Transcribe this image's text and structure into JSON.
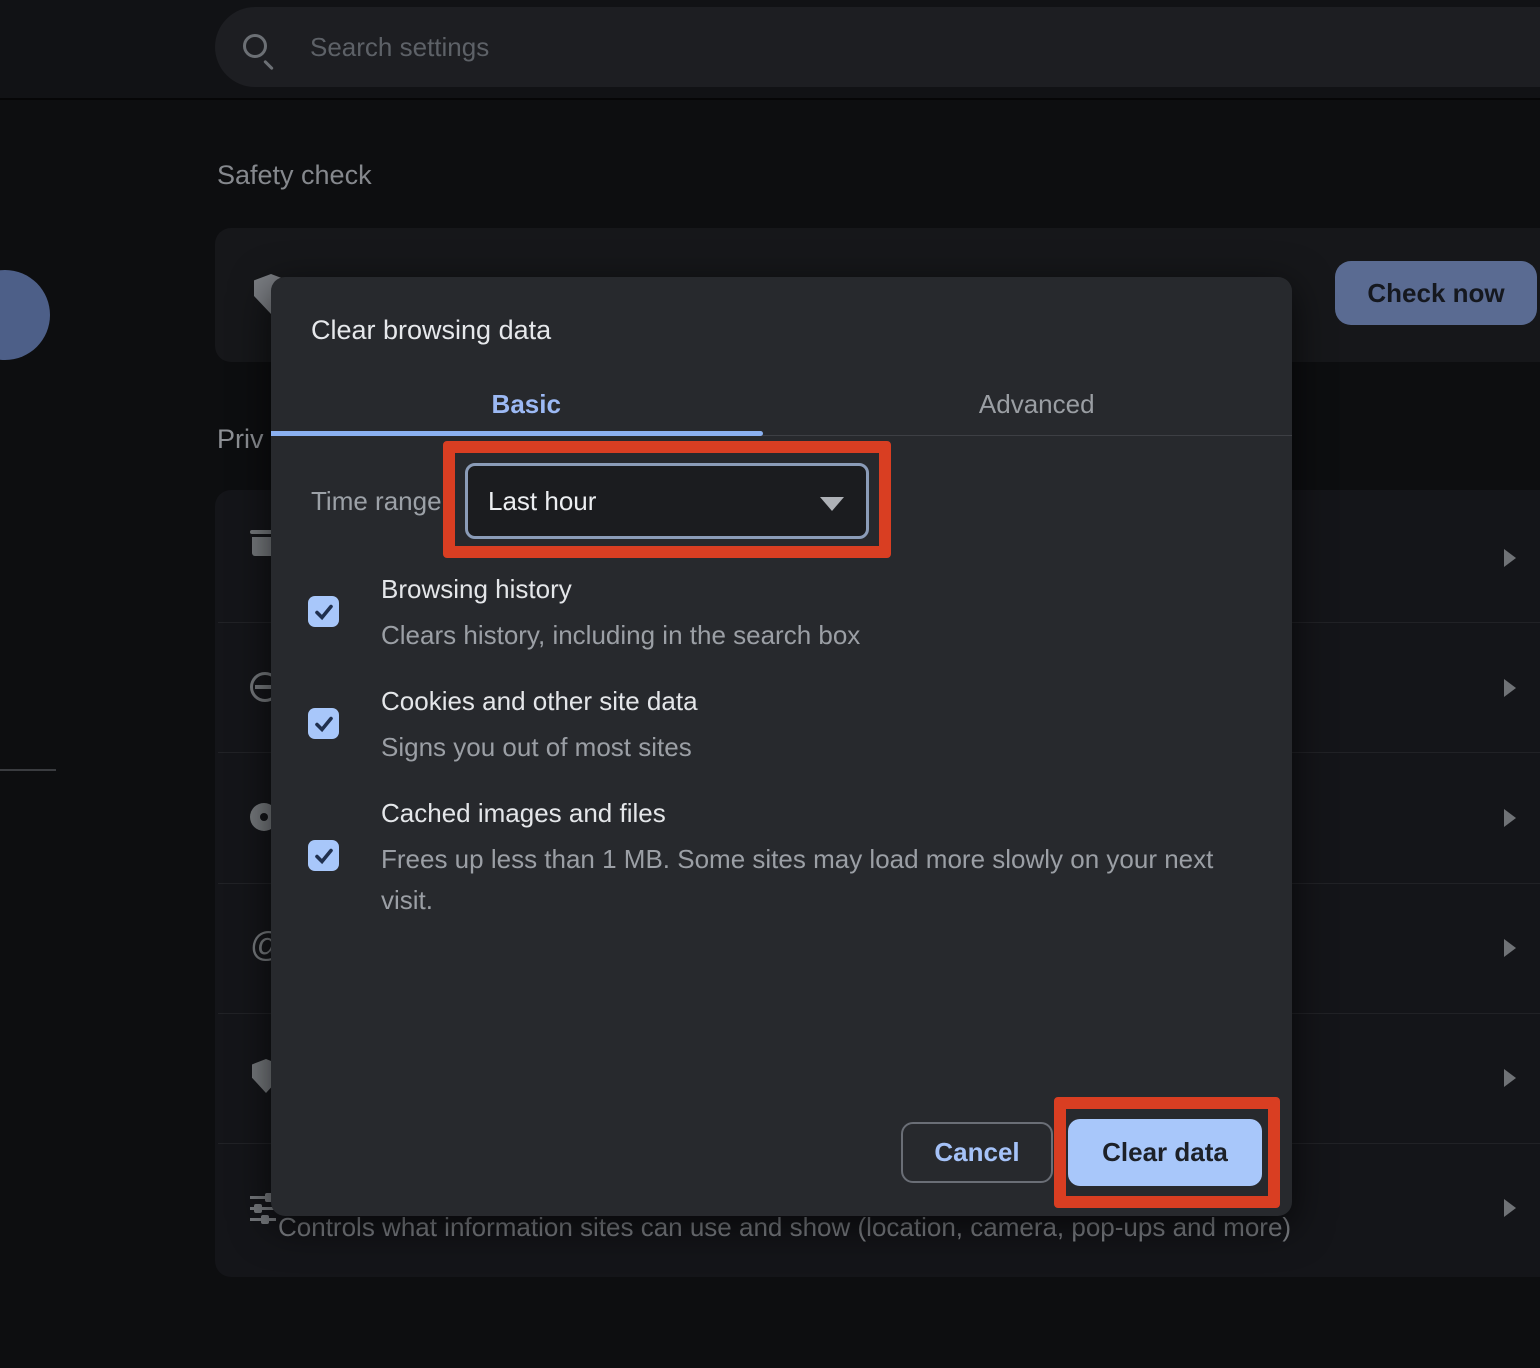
{
  "topbar": {
    "search_placeholder": "Search settings"
  },
  "background": {
    "safety_check_heading": "Safety check",
    "check_now_button": "Check now",
    "privacy_heading_partial": "Priv",
    "site_settings_subtitle": "Controls what information sites can use and show (location, camera, pop-ups and more)",
    "list_chevron_count": 6
  },
  "dialog": {
    "title": "Clear browsing data",
    "tabs": {
      "basic": "Basic",
      "advanced": "Advanced",
      "active": "Basic"
    },
    "time_range_label": "Time range",
    "time_range_value": "Last hour",
    "options": [
      {
        "title": "Browsing history",
        "description": "Clears history, including in the search box",
        "checked": true
      },
      {
        "title": "Cookies and other site data",
        "description": "Signs you out of most sites",
        "checked": true
      },
      {
        "title": "Cached images and files",
        "description": "Frees up less than 1 MB. Some sites may load more slowly on your next visit.",
        "checked": true
      }
    ],
    "cancel_button": "Cancel",
    "confirm_button": "Clear data"
  },
  "icons": {
    "ad_privacy_glyph": "@"
  },
  "colors": {
    "accent_blue": "#a8c7fa",
    "annotation_red": "#d93e22",
    "check_now_dimmed": "#5a6b92",
    "dialog_background": "#27292d"
  }
}
